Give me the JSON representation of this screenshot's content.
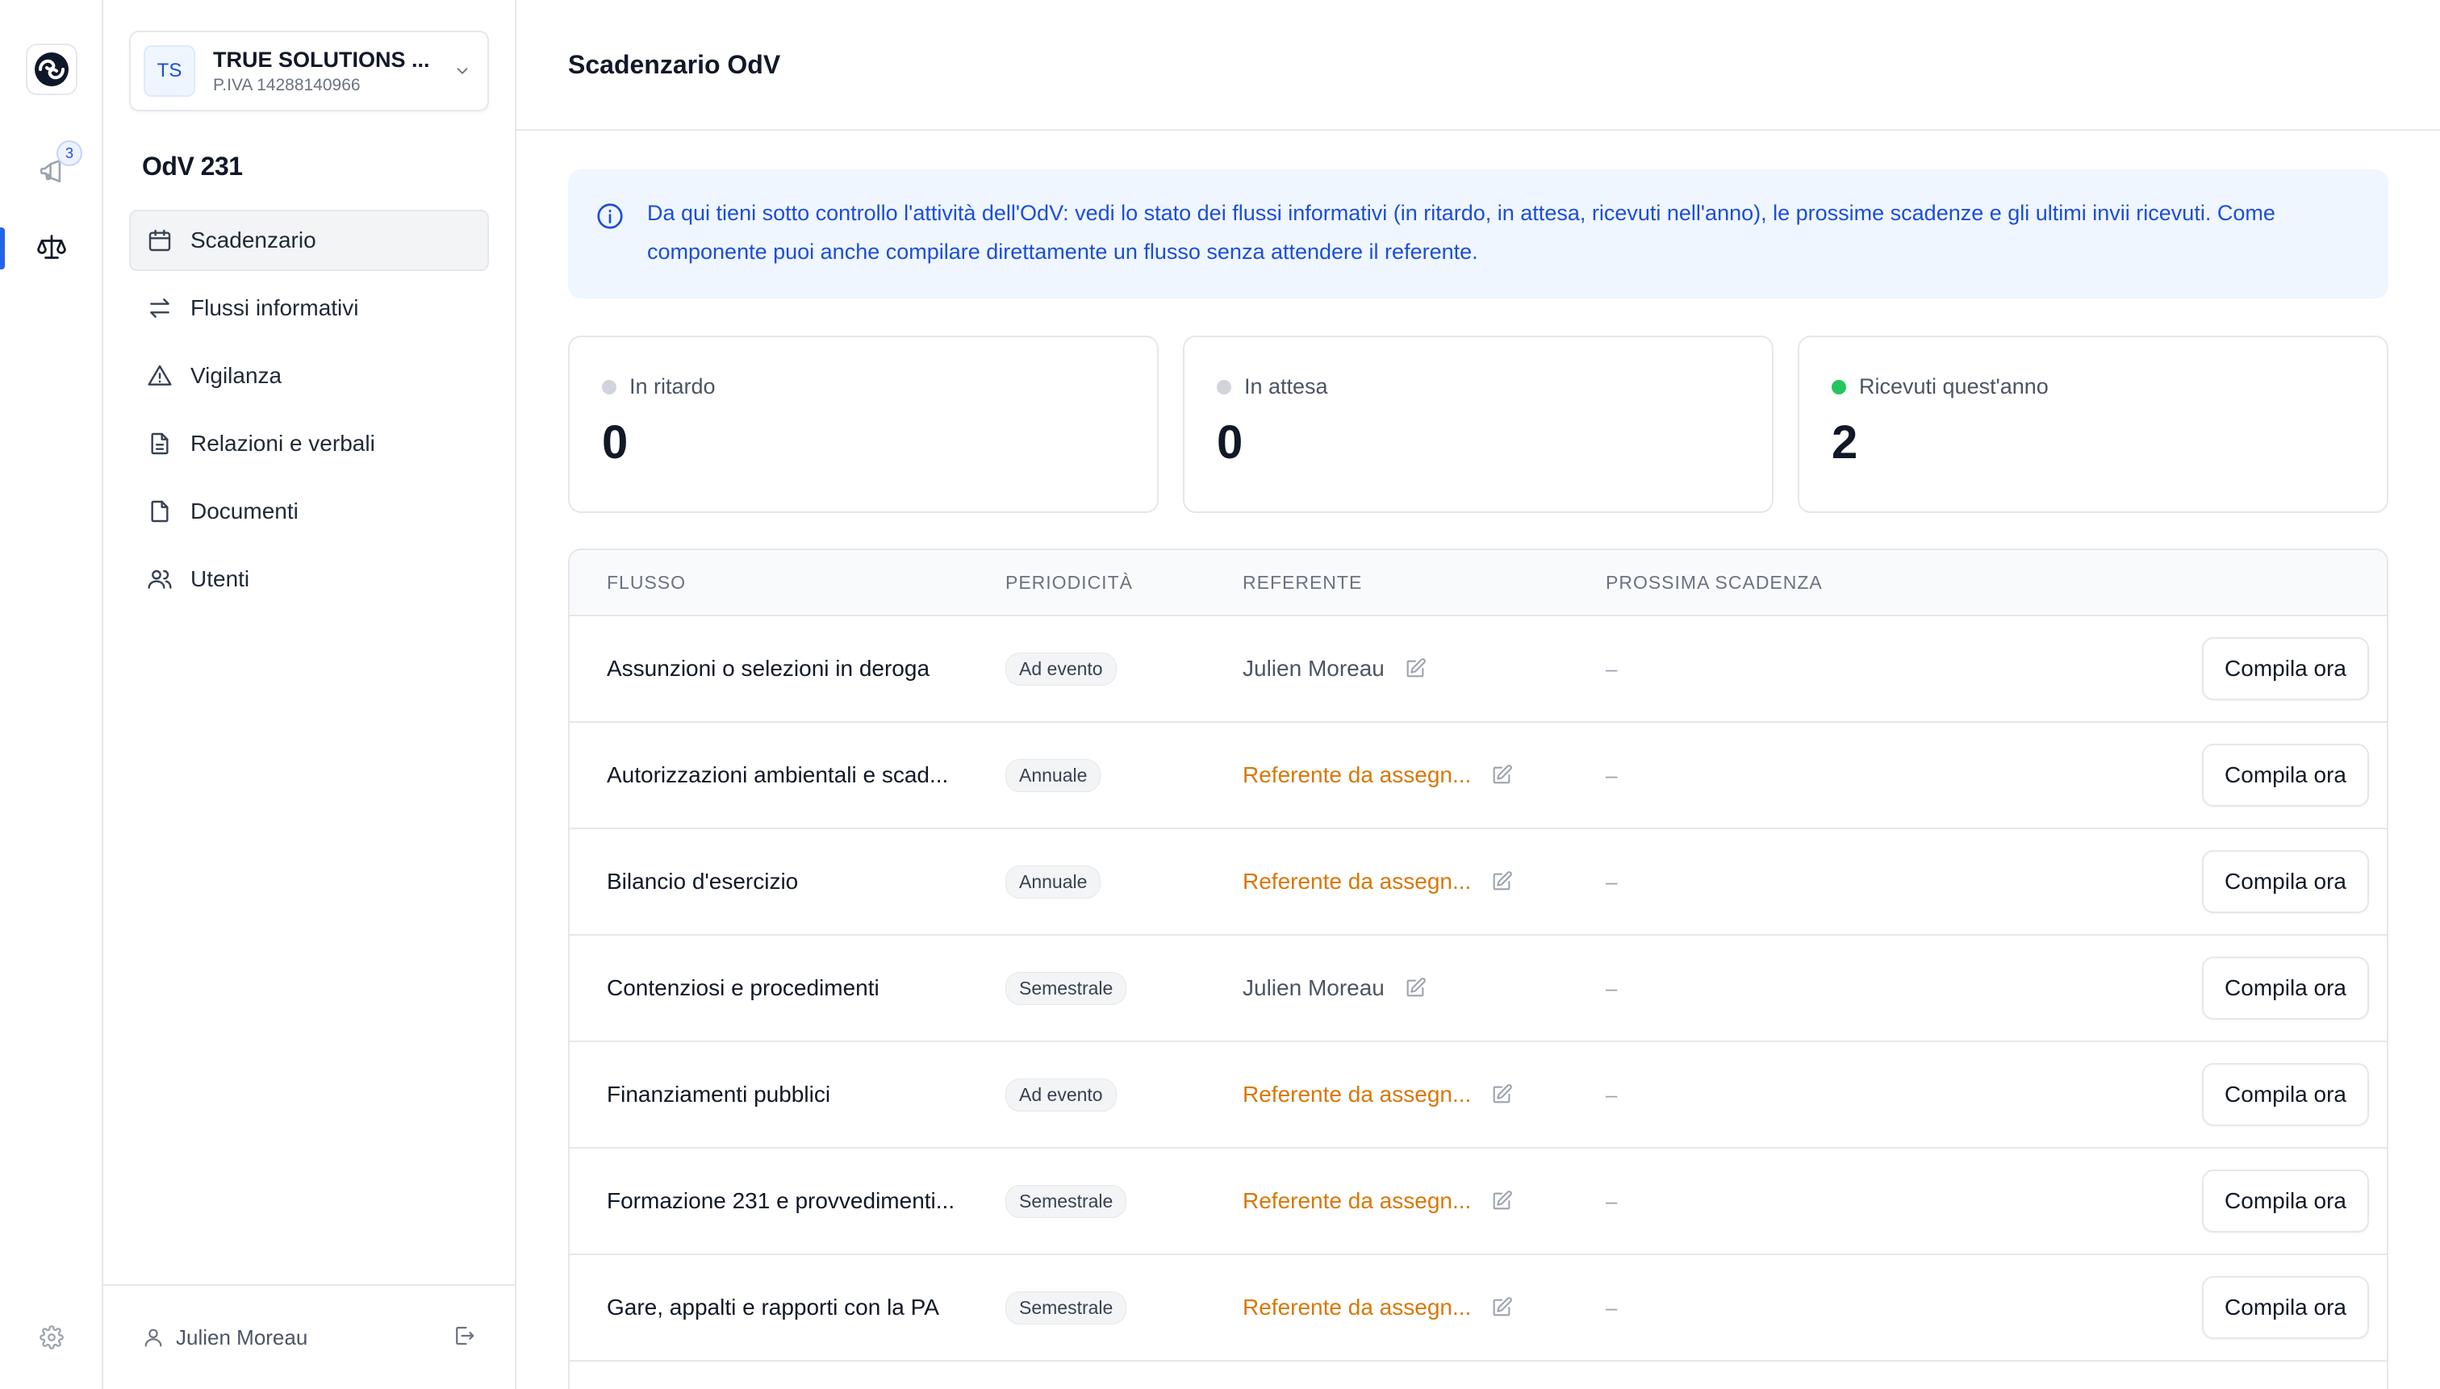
{
  "rail": {
    "notifications_count": "3"
  },
  "sidebar": {
    "org": {
      "initials": "TS",
      "name": "TRUE SOLUTIONS ...",
      "vat": "P.IVA 14288140966"
    },
    "section_title": "OdV 231",
    "nav": [
      {
        "label": "Scadenzario",
        "icon": "calendar-icon",
        "active": true
      },
      {
        "label": "Flussi informativi",
        "icon": "arrows-exchange-icon"
      },
      {
        "label": "Vigilanza",
        "icon": "warning-triangle-icon"
      },
      {
        "label": "Relazioni e verbali",
        "icon": "document-text-icon"
      },
      {
        "label": "Documenti",
        "icon": "document-icon"
      },
      {
        "label": "Utenti",
        "icon": "users-icon"
      }
    ],
    "footer_user": "Julien Moreau"
  },
  "header": {
    "title": "Scadenzario OdV"
  },
  "info": {
    "text": "Da qui tieni sotto controllo l'attività dell'OdV: vedi lo stato dei flussi informativi (in ritardo, in attesa, ricevuti nell'anno), le prossime scadenze e gli ultimi invii ricevuti. Come componente puoi anche compilare direttamente un flusso senza attendere il referente."
  },
  "stats": [
    {
      "label": "In ritardo",
      "value": "0",
      "dot_color": "#d1d5db"
    },
    {
      "label": "In attesa",
      "value": "0",
      "dot_color": "#d1d5db"
    },
    {
      "label": "Ricevuti quest'anno",
      "value": "2",
      "dot_color": "#22c55e"
    }
  ],
  "table": {
    "columns": [
      "FLUSSO",
      "PERIODICITÀ",
      "REFERENTE",
      "PROSSIMA SCADENZA"
    ],
    "action_label": "Compila ora",
    "rows": [
      {
        "flow": "Assunzioni o selezioni in deroga",
        "period": "Ad evento",
        "referent": "Julien Moreau",
        "assigned": true,
        "next_due": "–"
      },
      {
        "flow": "Autorizzazioni ambientali e scad...",
        "period": "Annuale",
        "referent": "Referente da assegn...",
        "assigned": false,
        "next_due": "–"
      },
      {
        "flow": "Bilancio d'esercizio",
        "period": "Annuale",
        "referent": "Referente da assegn...",
        "assigned": false,
        "next_due": "–"
      },
      {
        "flow": "Contenziosi e procedimenti",
        "period": "Semestrale",
        "referent": "Julien Moreau",
        "assigned": true,
        "next_due": "–"
      },
      {
        "flow": "Finanziamenti pubblici",
        "period": "Ad evento",
        "referent": "Referente da assegn...",
        "assigned": false,
        "next_due": "–"
      },
      {
        "flow": "Formazione 231 e provvedimenti...",
        "period": "Semestrale",
        "referent": "Referente da assegn...",
        "assigned": false,
        "next_due": "–"
      },
      {
        "flow": "Gare, appalti e rapporti con la PA",
        "period": "Semestrale",
        "referent": "Referente da assegn...",
        "assigned": false,
        "next_due": "–"
      }
    ]
  },
  "colors": {
    "accent": "#2563eb",
    "info_bg": "#eff6ff",
    "info_text": "#1d4ed8",
    "unassigned": "#d97706",
    "received_dot": "#22c55e"
  }
}
